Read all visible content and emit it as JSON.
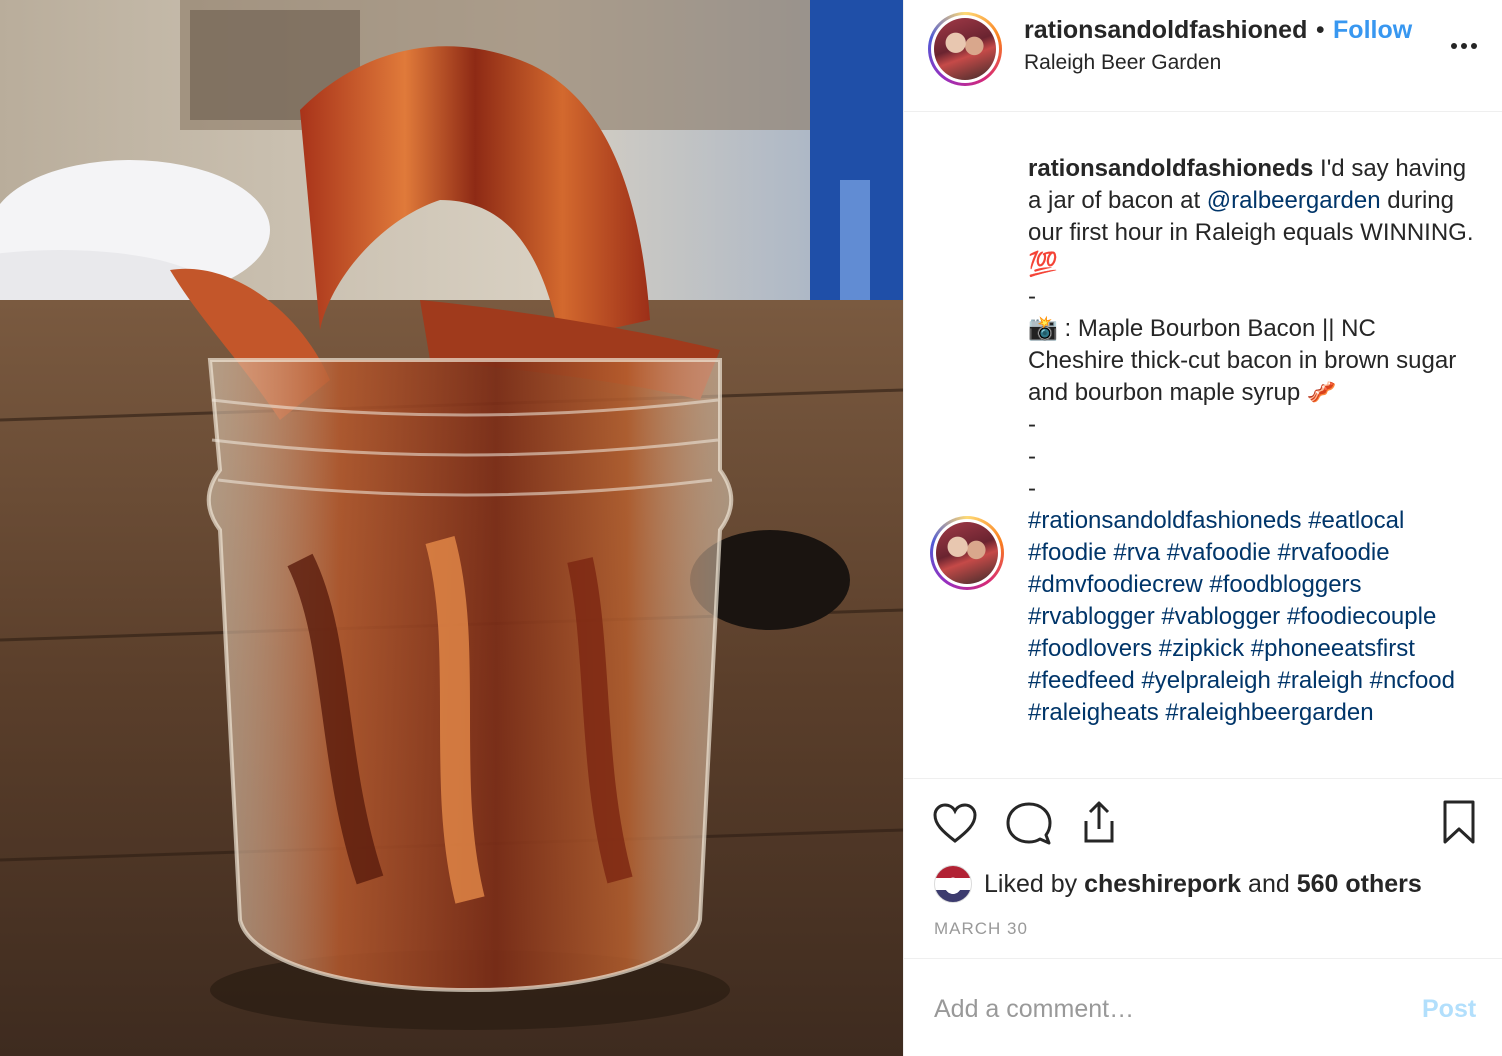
{
  "post": {
    "image": {
      "subject": "bacon-jar-photo"
    },
    "header": {
      "username": "rationsandoldfashioned",
      "separator": "•",
      "follow_label": "Follow",
      "location": "Raleigh Beer Garden",
      "more_icon": "more-horizontal-icon"
    },
    "caption": {
      "username": "rationsandoldfashioneds",
      "line1_a": "I'd say having a jar of bacon at",
      "mention": "@ralbeergarden",
      "line1_b": "during our first hour in Raleigh equals WINNING. 💯",
      "dash1": "-",
      "line2": "📸 : Maple Bourbon Bacon || NC Cheshire thick-cut bacon in brown sugar and bourbon maple syrup 🥓",
      "dash2": "-",
      "dash3": "-",
      "dash4": "-",
      "hashtags": "#rationsandoldfashioneds #eatlocal #foodie #rva #vafoodie #rvafoodie #dmvfoodiecrew #foodbloggers #rvablogger #vablogger #foodiecouple #foodlovers #zipkick #phoneeatsfirst #feedfeed #yelpraleigh #raleigh #ncfood #raleigheats #raleighbeergarden"
    },
    "actions": {
      "like_icon": "heart-icon",
      "comment_icon": "comment-icon",
      "share_icon": "share-icon",
      "save_icon": "bookmark-icon"
    },
    "likes": {
      "prefix": "Liked by",
      "liker": "cheshirepork",
      "middle": "and",
      "others": "560 others"
    },
    "date": "MARCH 30",
    "comment": {
      "placeholder": "Add a comment…",
      "post_label": "Post"
    }
  },
  "colors": {
    "link": "#003569",
    "follow": "#3897f0",
    "post_disabled": "#b2dffc",
    "muted": "#999999",
    "text": "#262626"
  }
}
